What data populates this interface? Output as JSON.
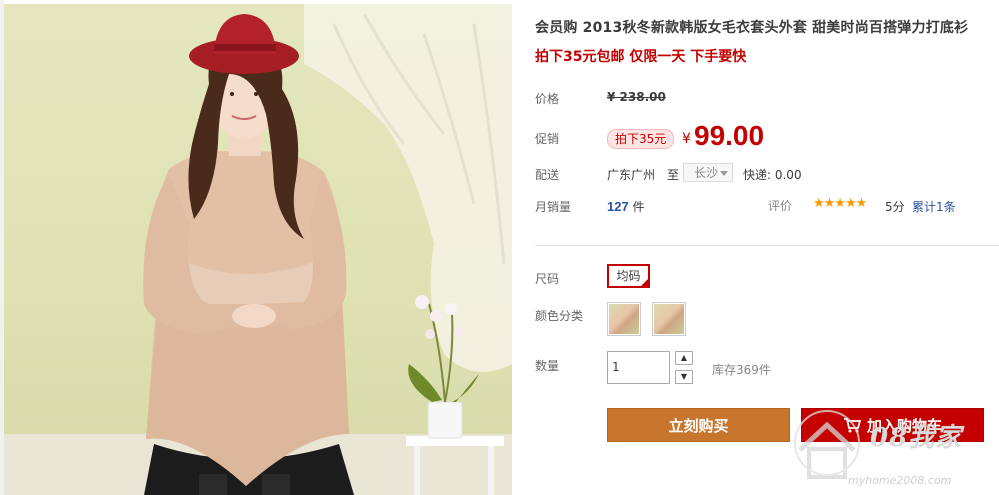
{
  "product": {
    "title": "会员购 2013秋冬新款韩版女毛衣套头外套 甜美时尚百搭弹力打底衫",
    "subtitle": "拍下35元包邮 仅限一天 下手要快"
  },
  "price_row": {
    "label": "价格",
    "currency": "¥",
    "original": "238.00"
  },
  "promo_row": {
    "label": "促销",
    "tag": "拍下35元",
    "currency": "¥",
    "price": "99.00"
  },
  "shipping_row": {
    "label": "配送",
    "from": "广东广州",
    "to_label": "至",
    "to_city": "长沙",
    "fee": "快递: 0.00"
  },
  "sales_row": {
    "label": "月销量",
    "count": "127",
    "unit": "件",
    "rating_label": "评价",
    "stars": "★★★★★",
    "score": "5分",
    "reviews": "累计1条"
  },
  "options": {
    "size_label": "尺码",
    "size_value": "均码",
    "color_label": "颜色分类",
    "quantity_label": "数量",
    "quantity_value": "1",
    "stock": "库存369件"
  },
  "actions": {
    "buy_now": "立刻购买",
    "add_to_cart": "加入购物车"
  },
  "watermark": {
    "text": "08我家",
    "url": "myhome2008.com"
  },
  "colors": {
    "accent_red": "#c40000",
    "buy_orange": "#c8762e",
    "link_blue": "#2953a6",
    "star_orange": "#ff9a00"
  }
}
